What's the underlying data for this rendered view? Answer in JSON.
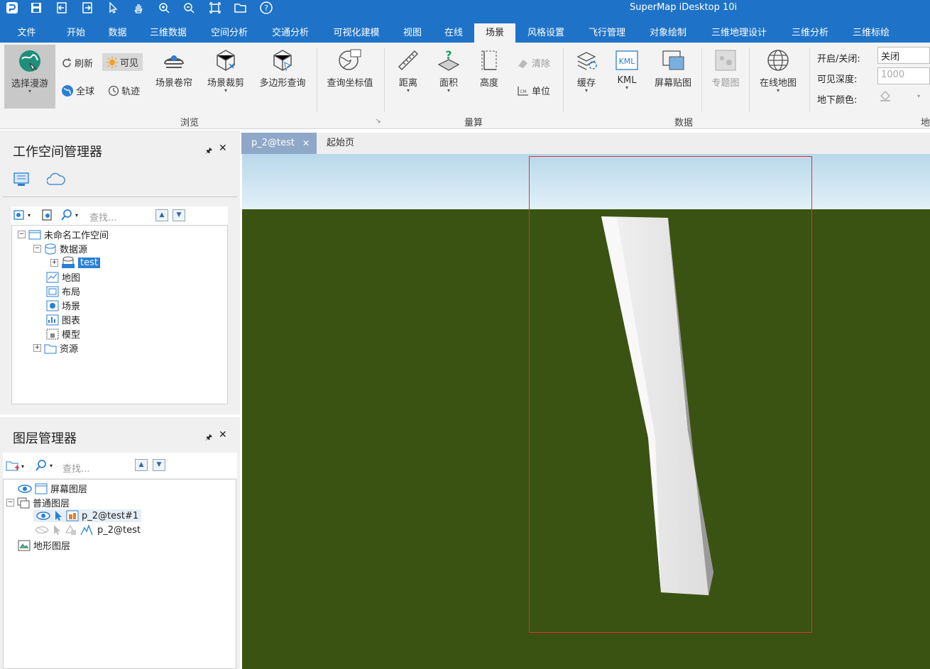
{
  "app": {
    "title": "SuperMap iDesktop 10i"
  },
  "tabs": [
    {
      "label": "文件"
    },
    {
      "label": "开始"
    },
    {
      "label": "数据"
    },
    {
      "label": "三维数据"
    },
    {
      "label": "空间分析"
    },
    {
      "label": "交通分析"
    },
    {
      "label": "可视化建模"
    },
    {
      "label": "视图"
    },
    {
      "label": "在线"
    },
    {
      "label": "场景"
    },
    {
      "label": "风格设置"
    },
    {
      "label": "飞行管理"
    },
    {
      "label": "对象绘制"
    },
    {
      "label": "三维地理设计"
    },
    {
      "label": "三维分析"
    },
    {
      "label": "三维标绘"
    }
  ],
  "ribbon": {
    "browse": {
      "select_roam": "选择漫游",
      "refresh": "刷新",
      "visible": "可见",
      "globe": "全球",
      "track": "轨迹",
      "scene_curtain": "场景卷帘",
      "scene_clip": "场景裁剪",
      "polygon_query": "多边形查询",
      "query_coord": "查询坐标值",
      "group": "浏览"
    },
    "measure": {
      "distance": "距离",
      "area": "面积",
      "height": "高度",
      "clear": "清除",
      "unit": "单位",
      "group": "量算"
    },
    "data": {
      "cache": "缓存",
      "kml": "KML",
      "screen_map": "屏幕贴图",
      "thematic": "专题图",
      "online_map": "在线地图",
      "group": "数据"
    },
    "underground": {
      "toggle_label": "开启/关闭:",
      "toggle_value": "关闭",
      "depth_label": "可见深度:",
      "depth_value": "1000",
      "color_label": "地下颜色:",
      "group": "地"
    }
  },
  "workspace": {
    "title": "工作空间管理器",
    "search_placeholder": "查找...",
    "tree": {
      "root": "未命名工作空间",
      "datasource": "数据源",
      "test": "test",
      "map": "地图",
      "layout": "布局",
      "scene": "场景",
      "chart": "图表",
      "model": "模型",
      "resource": "资源"
    }
  },
  "layers": {
    "title": "图层管理器",
    "search_placeholder": "查找...",
    "tree": {
      "screen_layer": "屏幕图层",
      "normal_layer": "普通图层",
      "layer1": "p_2@test#1",
      "layer2": "p_2@test",
      "terrain_layer": "地形图层"
    }
  },
  "doc_tabs": [
    {
      "label": "p_2@test"
    },
    {
      "label": "起始页"
    }
  ],
  "colors": {
    "brand": "#1e73c8",
    "ground": "#3a5312",
    "selection": "#e0303a"
  }
}
